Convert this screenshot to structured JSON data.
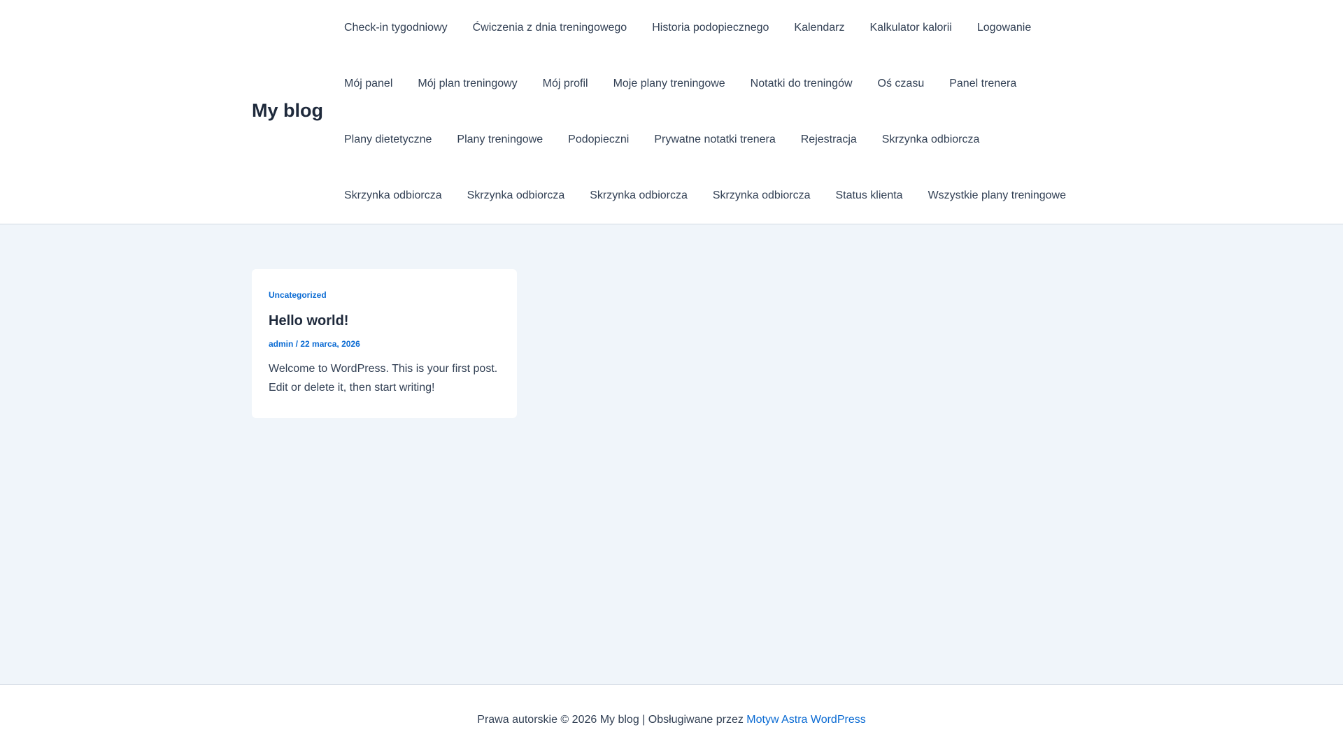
{
  "site": {
    "title": "My blog"
  },
  "nav": {
    "rows": [
      [
        "Check-in tygodniowy",
        "Ćwiczenia z dnia treningowego",
        "Historia podopiecznego",
        "Kalendarz",
        "Kalkulator kalorii",
        "Logowanie"
      ],
      [
        "Mój panel",
        "Mój plan treningowy",
        "Mój profil",
        "Moje plany treningowe",
        "Notatki do treningów",
        "Oś czasu",
        "Panel trenera"
      ],
      [
        "Plany dietetyczne",
        "Plany treningowe",
        "Podopieczni",
        "Prywatne notatki trenera",
        "Rejestracja",
        "Skrzynka odbiorcza"
      ],
      [
        "Skrzynka odbiorcza",
        "Skrzynka odbiorcza",
        "Skrzynka odbiorcza",
        "Skrzynka odbiorcza",
        "Status klienta",
        "Wszystkie plany treningowe"
      ]
    ]
  },
  "post": {
    "category": "Uncategorized",
    "title": "Hello world!",
    "author": "admin",
    "separator": " / ",
    "date": "22 marca, 2026",
    "excerpt": "Welcome to WordPress. This is your first post. Edit or delete it, then start writing!"
  },
  "footer": {
    "text": "Prawa autorskie © 2026 My blog | Obsługiwane przez ",
    "link": "Motyw Astra WordPress"
  }
}
